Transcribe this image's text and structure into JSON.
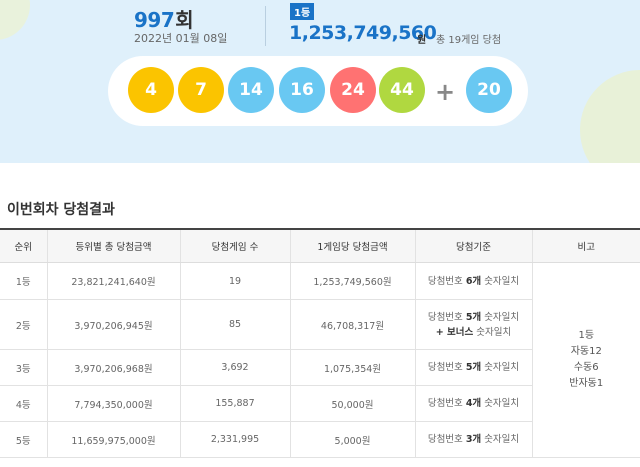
{
  "header": {
    "round_number": "997",
    "round_suffix": "회",
    "draw_date": "2022년 01월 08일",
    "first_prize_badge": "1등",
    "first_prize_amount": "1,253,749,560",
    "first_prize_unit": "원",
    "winners_note": "총 19게임 당첨"
  },
  "balls": [
    {
      "number": "4",
      "color": "#fbc400"
    },
    {
      "number": "7",
      "color": "#fbc400"
    },
    {
      "number": "14",
      "color": "#69c8f2"
    },
    {
      "number": "16",
      "color": "#69c8f2"
    },
    {
      "number": "24",
      "color": "#ff7272"
    },
    {
      "number": "44",
      "color": "#b0d840"
    }
  ],
  "plus_sign": "+",
  "bonus_ball": {
    "number": "20",
    "color": "#69c8f2"
  },
  "results": {
    "title": "이번회차 당첨결과",
    "headers": [
      "순위",
      "등위별 총 당첨금액",
      "당첨게임 수",
      "1게임당 당첨금액",
      "당첨기준",
      "비고"
    ],
    "rows": [
      {
        "rank": "1등",
        "total": "23,821,241,640원",
        "games": "19",
        "per_game": "1,253,749,560원",
        "basis": {
          "pre": "당첨번호 ",
          "bold": "6개",
          "post": " 숫자일치",
          "line2": ""
        }
      },
      {
        "rank": "2등",
        "total": "3,970,206,945원",
        "games": "85",
        "per_game": "46,708,317원",
        "basis": {
          "pre": "당첨번호 ",
          "bold": "5개",
          "post": " 숫자일치",
          "line2_bold": "+ 보너스",
          "line2": " 숫자일치"
        }
      },
      {
        "rank": "3등",
        "total": "3,970,206,968원",
        "games": "3,692",
        "per_game": "1,075,354원",
        "basis": {
          "pre": "당첨번호 ",
          "bold": "5개",
          "post": " 숫자일치",
          "line2": ""
        }
      },
      {
        "rank": "4등",
        "total": "7,794,350,000원",
        "games": "155,887",
        "per_game": "50,000원",
        "basis": {
          "pre": "당첨번호 ",
          "bold": "4개",
          "post": " 숫자일치",
          "line2": ""
        }
      },
      {
        "rank": "5등",
        "total": "11,659,975,000원",
        "games": "2,331,995",
        "per_game": "5,000원",
        "basis": {
          "pre": "당첨번호 ",
          "bold": "3개",
          "post": " 숫자일치",
          "line2": ""
        }
      }
    ],
    "remarks": [
      "1등",
      "자동12",
      "수동6",
      "반자동1"
    ]
  }
}
